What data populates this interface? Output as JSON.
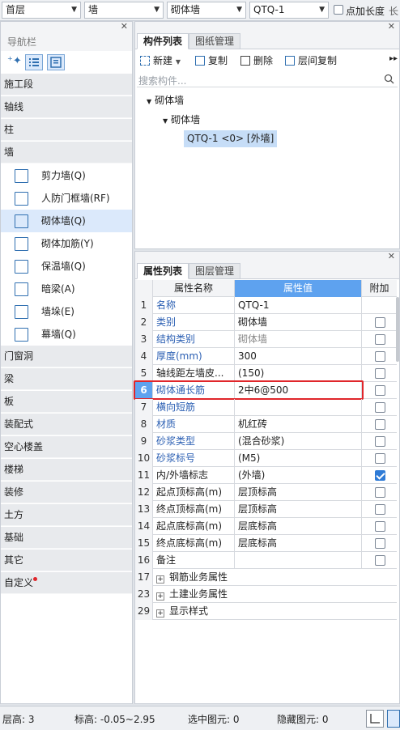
{
  "toolbar": {
    "floor": "首层",
    "category": "墙",
    "type": "砌体墙",
    "component": "QTQ-1",
    "point_length_label": "点加长度",
    "extra": "长"
  },
  "nav": {
    "title": "导航栏",
    "groups_top": [
      "施工段",
      "轴线",
      "柱",
      "墙"
    ],
    "wall_items": [
      {
        "label": "剪力墙(Q)",
        "icon": "shear-wall-icon"
      },
      {
        "label": "人防门框墙(RF)",
        "icon": "civil-defense-door-wall-icon"
      },
      {
        "label": "砌体墙(Q)",
        "icon": "masonry-wall-icon"
      },
      {
        "label": "砌体加筋(Y)",
        "icon": "masonry-reinforcement-icon"
      },
      {
        "label": "保温墙(Q)",
        "icon": "insulation-wall-icon"
      },
      {
        "label": "暗梁(A)",
        "icon": "hidden-beam-icon"
      },
      {
        "label": "墙垛(E)",
        "icon": "wall-pier-icon"
      },
      {
        "label": "幕墙(Q)",
        "icon": "curtain-wall-icon"
      }
    ],
    "groups_bottom": [
      "门窗洞",
      "梁",
      "板",
      "装配式",
      "空心楼盖",
      "楼梯",
      "装修",
      "土方",
      "基础",
      "其它",
      "自定义"
    ]
  },
  "components": {
    "tab_active": "构件列表",
    "tab_inactive": "图纸管理",
    "btn_new": "新建",
    "btn_copy": "复制",
    "btn_delete": "删除",
    "btn_floor_copy": "层间复制",
    "search_placeholder": "搜索构件...",
    "tree_root": "砌体墙",
    "tree_child": "砌体墙",
    "tree_leaf": "QTQ-1 <0> [外墙]"
  },
  "props": {
    "tab_active": "属性列表",
    "tab_inactive": "图层管理",
    "col_name": "属性名称",
    "col_value": "属性值",
    "col_extra": "附加",
    "rows": [
      {
        "n": "1",
        "name": "名称",
        "value": "QTQ-1",
        "blue": true,
        "cb": false,
        "cbon": false
      },
      {
        "n": "2",
        "name": "类别",
        "value": "砌体墙",
        "blue": true,
        "cb": true,
        "cbon": false
      },
      {
        "n": "3",
        "name": "结构类别",
        "value": "砌体墙",
        "blue": true,
        "gray": true,
        "cb": true,
        "cbon": false
      },
      {
        "n": "4",
        "name": "厚度(mm)",
        "value": "300",
        "blue": true,
        "cb": true,
        "cbon": false
      },
      {
        "n": "5",
        "name": "轴线距左墙皮...",
        "value": "(150)",
        "blue": false,
        "cb": true,
        "cbon": false
      },
      {
        "n": "6",
        "name": "砌体通长筋",
        "value": "2中6@500",
        "blue": true,
        "cb": true,
        "cbon": false,
        "sel": true
      },
      {
        "n": "7",
        "name": "横向短筋",
        "value": "",
        "blue": true,
        "cb": true,
        "cbon": false
      },
      {
        "n": "8",
        "name": "材质",
        "value": "机红砖",
        "blue": true,
        "cb": true,
        "cbon": false
      },
      {
        "n": "9",
        "name": "砂浆类型",
        "value": "(混合砂浆)",
        "blue": true,
        "cb": true,
        "cbon": false
      },
      {
        "n": "10",
        "name": "砂浆标号",
        "value": "(M5)",
        "blue": true,
        "cb": true,
        "cbon": false
      },
      {
        "n": "11",
        "name": "内/外墙标志",
        "value": "(外墙)",
        "blue": false,
        "cb": true,
        "cbon": true
      },
      {
        "n": "12",
        "name": "起点顶标高(m)",
        "value": "层顶标高",
        "blue": false,
        "cb": true,
        "cbon": false
      },
      {
        "n": "13",
        "name": "终点顶标高(m)",
        "value": "层顶标高",
        "blue": false,
        "cb": true,
        "cbon": false
      },
      {
        "n": "14",
        "name": "起点底标高(m)",
        "value": "层底标高",
        "blue": false,
        "cb": true,
        "cbon": false
      },
      {
        "n": "15",
        "name": "终点底标高(m)",
        "value": "层底标高",
        "blue": false,
        "cb": true,
        "cbon": false
      },
      {
        "n": "16",
        "name": "备注",
        "value": "",
        "blue": false,
        "cb": true,
        "cbon": false
      }
    ],
    "groups": [
      {
        "n": "17",
        "name": "钢筋业务属性"
      },
      {
        "n": "23",
        "name": "土建业务属性"
      },
      {
        "n": "29",
        "name": "显示样式"
      }
    ]
  },
  "status": {
    "floor_height": "层高:  3",
    "elevation": "标高:  -0.05~2.95",
    "selected": "选中图元:  0",
    "hidden": "隐藏图元:  0"
  },
  "colors": {
    "accent": "#2f6fb0",
    "highlight": "#e0262b",
    "header_blue": "#5ea2ef"
  }
}
